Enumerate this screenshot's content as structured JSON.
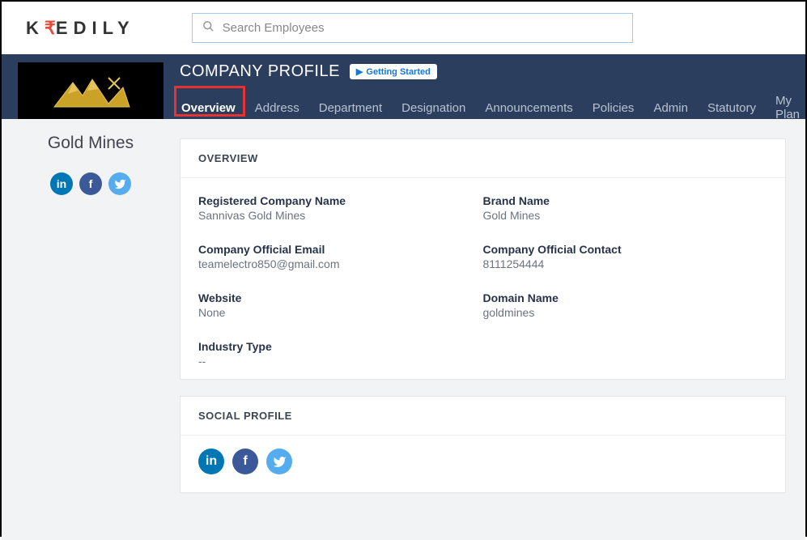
{
  "header": {
    "brand": "KREDILY",
    "search_placeholder": "Search Employees"
  },
  "page": {
    "title": "COMPANY PROFILE",
    "getting_started_label": "Getting Started",
    "tabs": [
      {
        "label": "Overview",
        "active": true
      },
      {
        "label": "Address"
      },
      {
        "label": "Department"
      },
      {
        "label": "Designation"
      },
      {
        "label": "Announcements"
      },
      {
        "label": "Policies"
      },
      {
        "label": "Admin"
      },
      {
        "label": "Statutory"
      },
      {
        "label": "My Plan"
      }
    ]
  },
  "sidebar": {
    "company_name": "Gold Mines",
    "social": {
      "linkedin": "in",
      "facebook": "f",
      "twitter": ""
    }
  },
  "overview_card": {
    "title": "OVERVIEW",
    "fields": {
      "registered_company_name": {
        "label": "Registered Company Name",
        "value": "Sannivas Gold Mines"
      },
      "brand_name": {
        "label": "Brand Name",
        "value": "Gold Mines"
      },
      "company_email": {
        "label": "Company Official Email",
        "value": "teamelectro850@gmail.com"
      },
      "company_contact": {
        "label": "Company Official Contact",
        "value": "8111254444"
      },
      "website": {
        "label": "Website",
        "value": "None"
      },
      "domain_name": {
        "label": "Domain Name",
        "value": "goldmines"
      },
      "industry_type": {
        "label": "Industry Type",
        "value": "--"
      }
    }
  },
  "social_card": {
    "title": "SOCIAL PROFILE"
  }
}
